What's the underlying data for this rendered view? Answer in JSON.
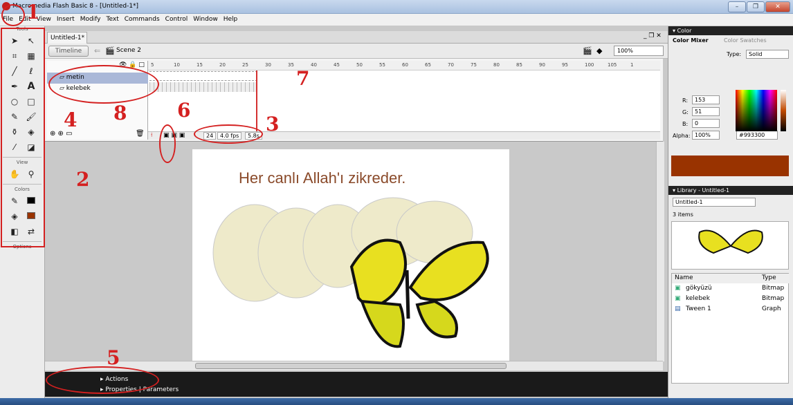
{
  "window": {
    "title": "Macromedia Flash Basic 8 - [Untitled-1*]",
    "controls": [
      "–",
      "❐",
      "✕"
    ]
  },
  "menu": [
    "File",
    "Edit",
    "View",
    "Insert",
    "Modify",
    "Text",
    "Commands",
    "Control",
    "Window",
    "Help"
  ],
  "tools": {
    "header": "Tools",
    "view_label": "View",
    "colors_label": "Colors",
    "options_label": "Options"
  },
  "document": {
    "tab": "Untitled-1*",
    "timeline_button": "Timeline",
    "scene": "Scene 2",
    "zoom": "100%"
  },
  "timeline": {
    "layers": [
      {
        "name": "metin"
      },
      {
        "name": "kelebek"
      }
    ],
    "ruler": [
      "5",
      "10",
      "15",
      "20",
      "25",
      "30",
      "35",
      "40",
      "45",
      "50",
      "55",
      "60",
      "65",
      "70",
      "75",
      "80",
      "85",
      "90",
      "95",
      "100",
      "105",
      "1"
    ],
    "frame": "24",
    "fps": "4.0 fps",
    "time": "5.8s"
  },
  "stage": {
    "headline": "Her canlı Allah'ı zikreder."
  },
  "panels": {
    "actions": "Actions",
    "properties": "Properties",
    "parameters": "Parameters"
  },
  "color_panel": {
    "header": "Color",
    "tab_mixer": "Color Mixer",
    "tab_swatches": "Color Swatches",
    "type_label": "Type:",
    "type_value": "Solid",
    "r_label": "R:",
    "r": "153",
    "g_label": "G:",
    "g": "51",
    "b_label": "B:",
    "b": "0",
    "alpha_label": "Alpha:",
    "alpha": "100%",
    "hex": "#993300",
    "fill_color": "#993300"
  },
  "library": {
    "header": "Library - Untitled-1",
    "doc": "Untitled-1",
    "count": "3 items",
    "col_name": "Name",
    "col_type": "Type",
    "items": [
      {
        "name": "gökyüzü",
        "type": "Bitmap"
      },
      {
        "name": "kelebek",
        "type": "Bitmap"
      },
      {
        "name": "Tween 1",
        "type": "Graph"
      }
    ]
  },
  "annotations": {
    "n1": "1",
    "n2": "2",
    "n3": "3",
    "n4": "4",
    "n5": "5",
    "n6": "6",
    "n7": "7",
    "n8": "8"
  },
  "colors": {
    "annotation": "#d42020",
    "headline": "#8a4a2a",
    "accent": "#993300"
  }
}
